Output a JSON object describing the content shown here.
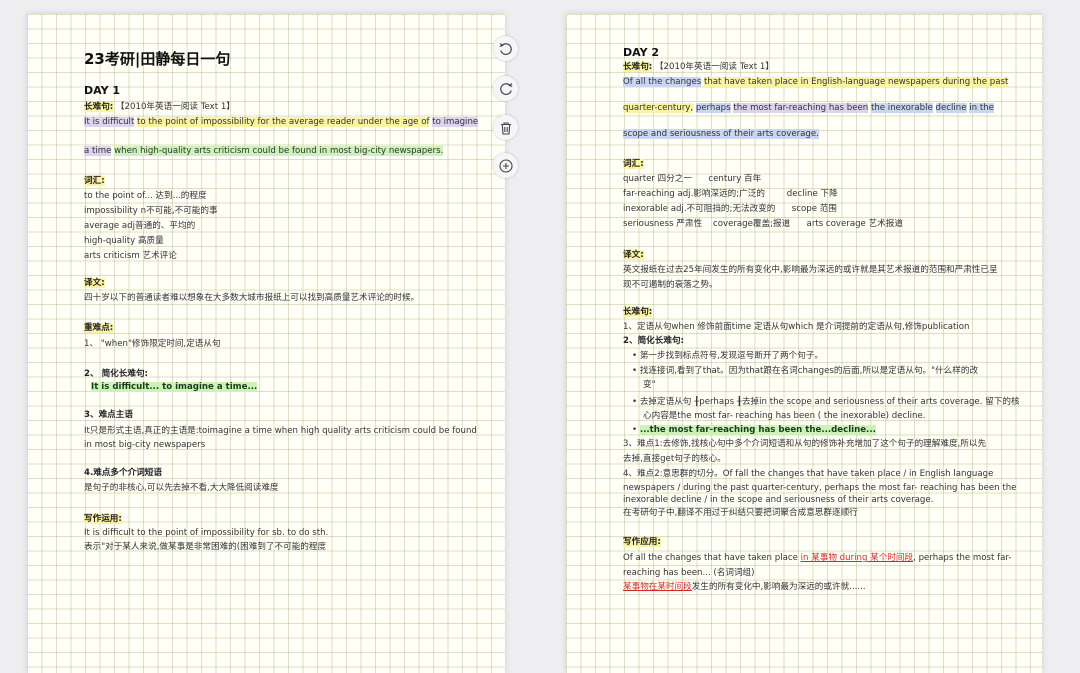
{
  "page1": {
    "title": "23考研|田静每日一句",
    "day": "DAY 1",
    "long_label": "长难句:",
    "long_source": "【2010年英语一阅读  Text 1】",
    "sentence": {
      "p1": "It is difficult",
      "p2": "to the point of impossibility for the average reader under the age of",
      "p3": "to imagine",
      "p4": "a time",
      "p5": "when high-quality arts criticism could be found in most big-city newspapers."
    },
    "vocab_label": "词汇:",
    "vocab": [
      "to the point of... 达到...的程度",
      "impossibility n不可能,不可能的事",
      "average adj普通的、平均的",
      "high-quality 高质量",
      "arts criticism 艺术评论"
    ],
    "translation_label": "译文:",
    "translation": "四十岁以下的普通读者难以想象在大多数大城市报纸上可以找到高质量艺术评论的时候。",
    "key_label": "重难点:",
    "key_1": "1、 \"when\"修饰限定时间,定语从句",
    "simplify_label": "2、 简化长难句:",
    "simplify_text": "It is difficult... to imagine a time...",
    "subject_label": "3、难点主语",
    "subject_line1": "It只是形式主语,真正的主语是:toimagine a time when high quality arts criticism could be found",
    "subject_line2": "in most big-city newspapers",
    "phrase_label": "4.难点多个介词短语",
    "phrase_text": "是句子的非核心,可以先去掉不看,大大降低阅读难度",
    "writing_label": "写作运用:",
    "writing_line1": "It is difficult to the point of impossibility for sb. to do sth.",
    "writing_line2": "表示\"对于某人来说,做某事是非常困难的(困难到了不可能的程度"
  },
  "toolbar": {
    "icons": [
      "rotate-left-icon",
      "rotate-right-icon",
      "trash-icon",
      "zoom-in-icon"
    ]
  },
  "page2": {
    "day": "DAY 2",
    "long_label": "长难句:",
    "long_source": "【2010年英语一阅读 Text 1】",
    "sentence": {
      "p1": "Of all the changes",
      "p2": "that have taken place in English-language newspapers during the past",
      "p3": "quarter-century,",
      "p4": "perhaps",
      "p5": "the most far-reaching has been",
      "p6": "the inexorable",
      "p7": "decline",
      "p8": "in the",
      "p9": "scope and seriousness of their arts coverage."
    },
    "vocab_label": "词汇:",
    "vocab": [
      "quarter 四分之一      century 百年",
      "far-reaching adj.影响深远的;广泛的        decline 下降",
      "inexorable adj.不可阻挡的;无法改变的      scope 范围",
      "seriousness 严肃性    coverage覆盖;报道      arts coverage 艺术报道"
    ],
    "translation_label": "译文:",
    "translation_line1": "英文报纸在过去25年间发生的所有变化中,影响最为深远的或许就是其艺术报道的范围和严肃性已呈",
    "translation_line2": "现不可遏制的衰落之势。",
    "analysis_label": "长难句:",
    "a1": "1、定语从句when 修饰前面time 定语从句which 是介词提前的定语从句,修饰publication",
    "a2": "2、简化长难句:",
    "b1": "第一步找到标点符号,发现逗号断开了两个句子。",
    "b2_line1": "找连接词,看到了that。因为that跟在名词changes的后面,所以是定语从句。\"什么样的改",
    "b2_line2": "变\"",
    "b3_line1": "去掉定语从句 ╂perhaps ╂去掉in the scope and seriousness of their arts coverage. 留下的核",
    "b3_line2": "心内容是the most far- reaching has been  ( the inexorable) decline.",
    "b4": "...the most far-reaching has been the...decline...",
    "a3_line1": "3、难点1:去修饰,找核心句中多个介词短语和从句的修饰补充增加了这个句子的理解难度,所以先",
    "a3_line2": "去掉,直接get句子的核心。",
    "a4_line1": "4、难点2:意思群的切分。Of fall the changes that have taken place / in English language",
    "a4_line2": "newspapers  / during the past quarter-century, perhaps the most far- reaching has been the",
    "a4_line3": "inexorable decline / in the scope and seriousness of their arts coverage.",
    "a4_line4": "在考研句子中,翻译不用过于纠结只要把词聚合成意思群逐顺行",
    "writing_label": "写作应用:",
    "w1_pre": "Of all the changes that have taken place ",
    "w1_red": "in 某事物 during 某个时间段",
    "w1_post": ", perhaps the most far-",
    "w2": "reaching has been... (名词词组)",
    "w3_red": "某事物在某时间段",
    "w3_post": "发生的所有变化中,影响最为深远的或许就......"
  }
}
